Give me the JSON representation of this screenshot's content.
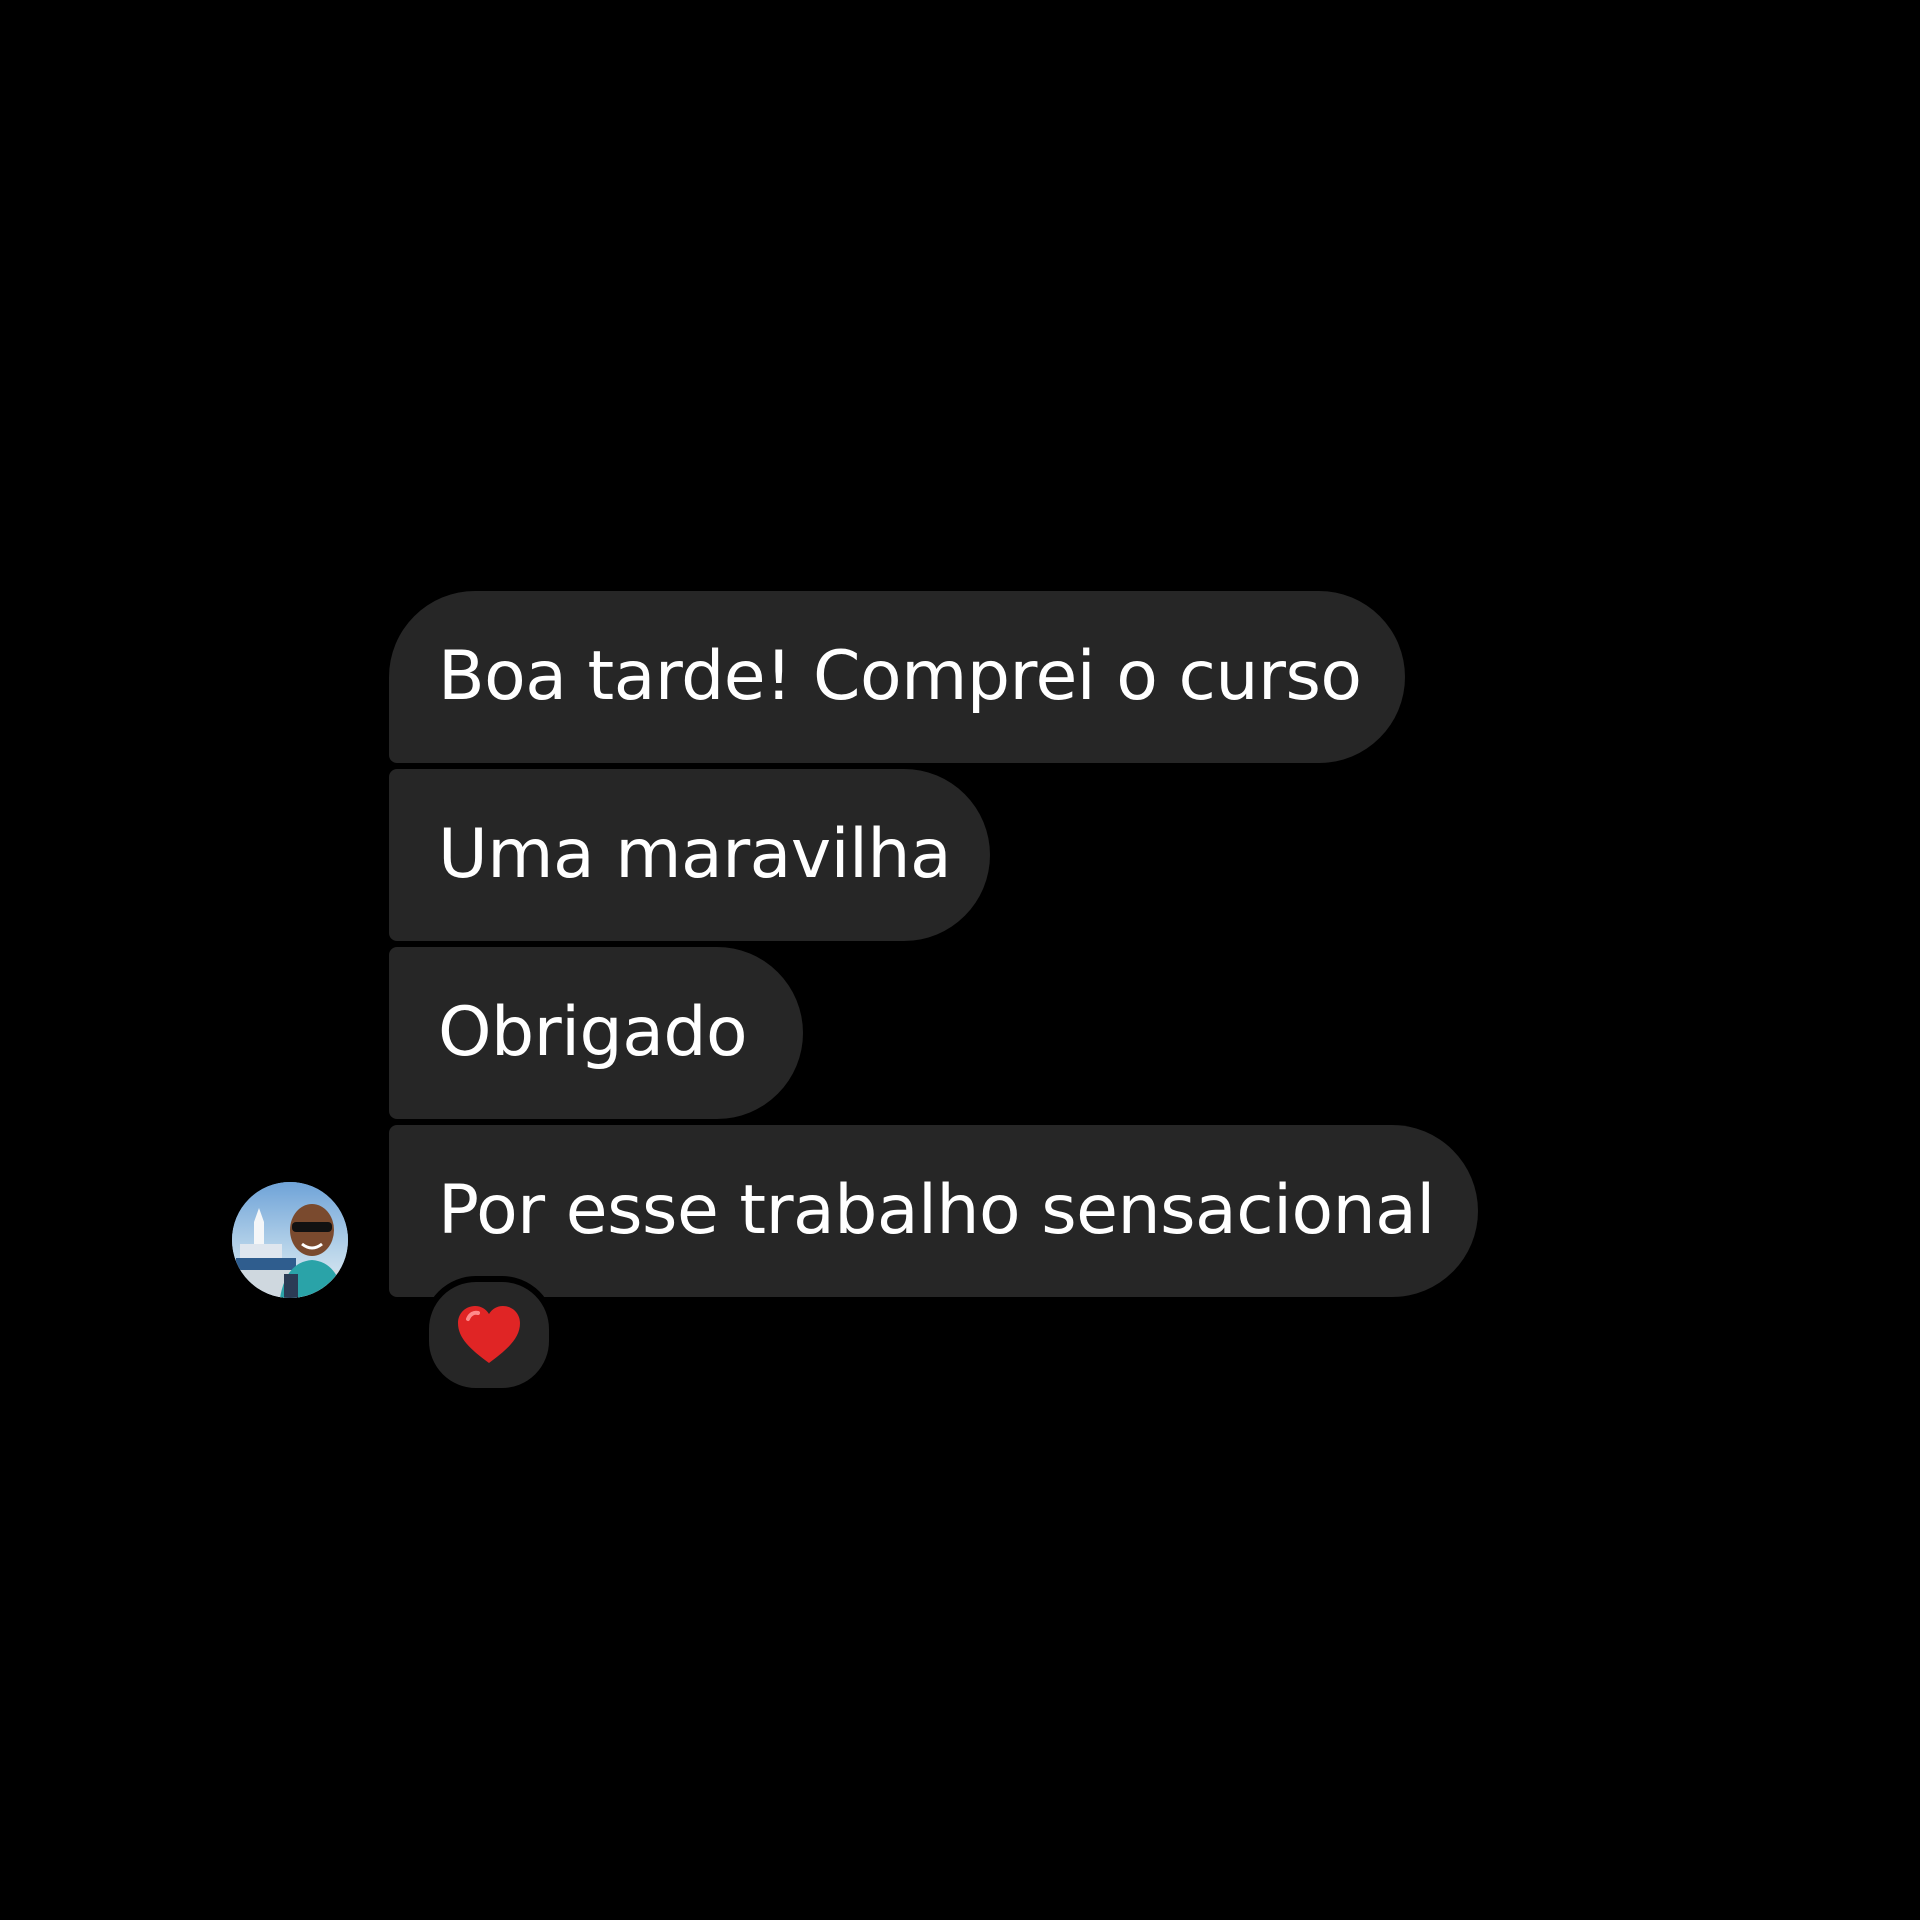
{
  "conversation": {
    "messages": [
      {
        "text": "Boa tarde! Comprei o curso"
      },
      {
        "text": "Uma maravilha"
      },
      {
        "text": "Obrigado"
      },
      {
        "text": "Por esse trabalho sensacional"
      }
    ],
    "reaction": {
      "icon": "heart-icon",
      "color": "#e02525"
    },
    "avatar": {
      "icon": "user-photo"
    }
  },
  "colors": {
    "background": "#000000",
    "bubble": "#262626",
    "text": "#ffffff"
  }
}
